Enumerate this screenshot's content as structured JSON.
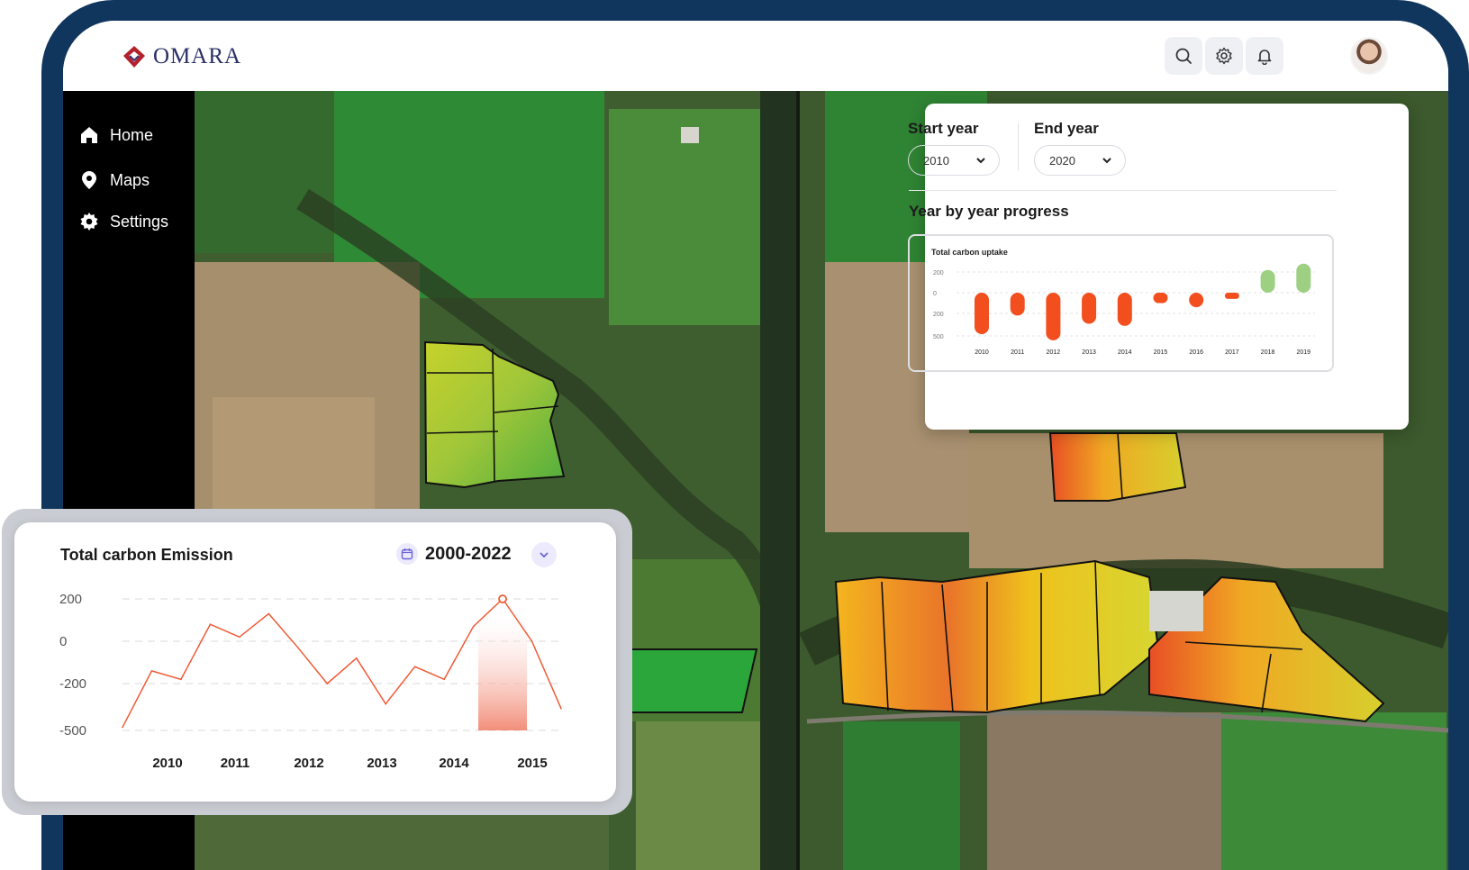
{
  "app": {
    "logo_text": "OMARA",
    "brand_color": "#11365e",
    "logo_color": "#b3202b"
  },
  "topbar": {
    "icons": [
      "search-icon",
      "gear-icon",
      "bell-icon",
      "avatar"
    ]
  },
  "sidebar": {
    "items": [
      {
        "label": "Home",
        "icon": "home-icon"
      },
      {
        "label": "Maps",
        "icon": "map-pin-icon"
      },
      {
        "label": "Settings",
        "icon": "gear-icon"
      }
    ]
  },
  "filter_panel": {
    "start_label": "Start year",
    "start_value": "2010",
    "end_label": "End year",
    "end_value": "2020",
    "section_title": "Year by year progress"
  },
  "emission_card": {
    "title": "Total carbon  Emission",
    "range": "2000-2022"
  },
  "chart_data": [
    {
      "type": "bar",
      "title": "Total carbon uptake",
      "yticks": [
        "200",
        "0",
        "200",
        "500"
      ],
      "categories": [
        "2010",
        "2011",
        "2012",
        "2013",
        "2014",
        "2015",
        "2016",
        "2017",
        "2018",
        "2019"
      ],
      "values": [
        -200,
        -110,
        -230,
        -150,
        -160,
        -50,
        -70,
        -30,
        110,
        140
      ],
      "colors": {
        "negative": "#f24e1e",
        "positive": "#9ed083"
      }
    },
    {
      "type": "line",
      "title": "",
      "yticks": [
        "200",
        "0",
        "-200",
        "-500"
      ],
      "xticks": [
        "2010",
        "2011",
        "2012",
        "2013",
        "2014",
        "2015"
      ],
      "values": [
        -480,
        -140,
        -180,
        80,
        20,
        130,
        -30,
        -200,
        -80,
        -330,
        -120,
        -180,
        70,
        200,
        0,
        -360
      ],
      "highlight_index": 13,
      "line_color": "#f15a36"
    }
  ]
}
